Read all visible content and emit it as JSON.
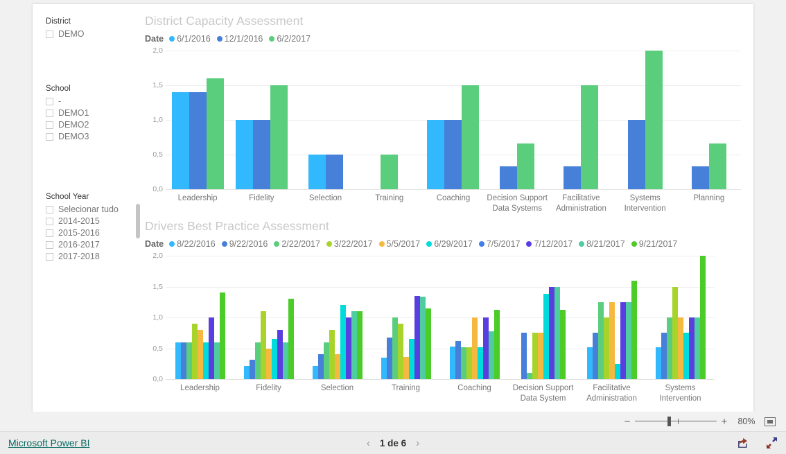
{
  "app": {
    "brand": "Microsoft Power BI",
    "pager": {
      "label": "1 de 6",
      "prev": "‹",
      "next": "›"
    },
    "zoom": {
      "minus": "−",
      "plus": "+",
      "percent": "80%"
    }
  },
  "slicers": [
    {
      "id": "district",
      "title": "District",
      "items": [
        "DEMO"
      ]
    },
    {
      "id": "school",
      "title": "School",
      "items": [
        "-",
        "DEMO1",
        "DEMO2",
        "DEMO3"
      ]
    },
    {
      "id": "year",
      "title": "School Year",
      "items": [
        "Selecionar tudo",
        "2014-2015",
        "2015-2016",
        "2016-2017",
        "2017-2018"
      ],
      "scrollbar": true
    }
  ],
  "chart_data": [
    {
      "id": "dca",
      "type": "bar",
      "title": "District Capacity Assessment",
      "legend_title": "Date",
      "legend_position": "top",
      "grid": true,
      "xlabel": "",
      "ylabel": "",
      "ylim": [
        0,
        2
      ],
      "yticks": [
        "0,0",
        "0,5",
        "1,0",
        "1,5",
        "2,0"
      ],
      "ytick_values": [
        0,
        0.5,
        1.0,
        1.5,
        2.0
      ],
      "categories": [
        "Leadership",
        "Fidelity",
        "Selection",
        "Training",
        "Coaching",
        "Decision Support Data Systems",
        "Facilitative Administration",
        "Systems Intervention",
        "Planning"
      ],
      "series": [
        {
          "name": "6/1/2016",
          "color": "#32b8fc",
          "values": [
            1.4,
            1.0,
            0.5,
            null,
            1.0,
            null,
            null,
            null,
            null
          ]
        },
        {
          "name": "12/1/2016",
          "color": "#4680d8",
          "values": [
            1.4,
            1.0,
            0.5,
            null,
            1.0,
            0.33,
            0.33,
            1.0,
            0.33
          ]
        },
        {
          "name": "6/2/2017",
          "color": "#5bce7e",
          "values": [
            1.6,
            1.5,
            null,
            0.5,
            1.5,
            0.66,
            1.5,
            2.0,
            0.66
          ]
        }
      ]
    },
    {
      "id": "dbpa",
      "type": "bar",
      "title": "Drivers Best Practice Assessment",
      "legend_title": "Date",
      "legend_position": "top",
      "grid": true,
      "xlabel": "",
      "ylabel": "",
      "ylim": [
        0,
        2
      ],
      "yticks": [
        "0,0",
        "0,5",
        "1,0",
        "1,5",
        "2,0"
      ],
      "ytick_values": [
        0,
        0.5,
        1.0,
        1.5,
        2.0
      ],
      "categories": [
        "Leadership",
        "Fidelity",
        "Selection",
        "Training",
        "Coaching",
        "Decision Support Data System",
        "Facilitative Administration",
        "Systems Intervention"
      ],
      "series": [
        {
          "name": "8/22/2016",
          "color": "#32b8fc",
          "values": [
            0.6,
            0.21,
            0.21,
            0.35,
            0.53,
            null,
            0.52,
            0.52
          ]
        },
        {
          "name": "9/22/2016",
          "color": "#4680d8",
          "values": [
            0.6,
            0.31,
            0.41,
            0.67,
            0.62,
            0.75,
            0.75,
            0.75
          ]
        },
        {
          "name": "2/22/2017",
          "color": "#5bce7e",
          "values": [
            0.6,
            0.6,
            0.6,
            1.0,
            0.52,
            0.1,
            1.25,
            1.0
          ]
        },
        {
          "name": "3/22/2017",
          "color": "#a8d32a",
          "values": [
            0.9,
            1.1,
            0.8,
            0.9,
            0.52,
            0.75,
            1.0,
            1.5
          ]
        },
        {
          "name": "5/5/2017",
          "color": "#f5b93f",
          "values": [
            0.8,
            0.5,
            0.41,
            0.36,
            1.0,
            0.75,
            1.25,
            1.0
          ]
        },
        {
          "name": "6/29/2017",
          "color": "#00dbdb",
          "values": [
            0.6,
            0.65,
            1.2,
            0.65,
            0.52,
            1.38,
            0.25,
            0.75
          ]
        },
        {
          "name": "7/5/2017",
          "color": "#3f7fe8",
          "values": [
            null,
            null,
            null,
            null,
            null,
            null,
            null,
            null
          ]
        },
        {
          "name": "7/12/2017",
          "color": "#5a3fe0",
          "values": [
            1.0,
            0.8,
            1.0,
            1.35,
            1.0,
            1.5,
            1.25,
            1.0
          ]
        },
        {
          "name": "8/21/2017",
          "color": "#4fcda0",
          "values": [
            0.6,
            0.6,
            1.1,
            1.34,
            0.78,
            1.5,
            1.25,
            1.0
          ]
        },
        {
          "name": "9/21/2017",
          "color": "#4bcc28",
          "values": [
            1.4,
            1.3,
            1.1,
            1.15,
            1.12,
            1.12,
            1.6,
            2.0
          ]
        }
      ]
    }
  ]
}
